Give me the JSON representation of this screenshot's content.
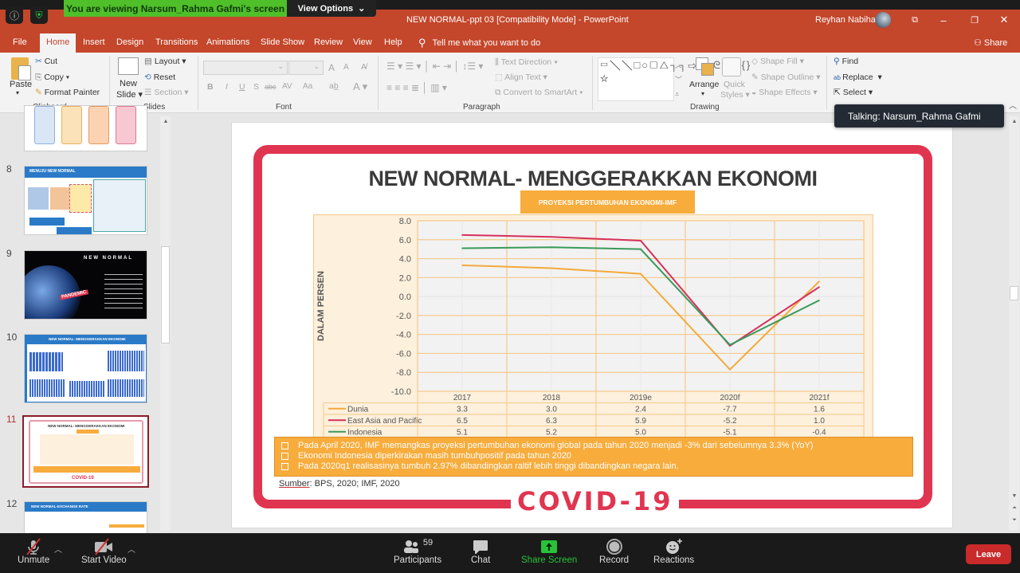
{
  "zoom": {
    "viewing_banner": "You are viewing Narsum_Rahma Gafmi's screen",
    "view_options": "View Options",
    "talking": "Talking: Narsum_Rahma Gafmi",
    "toolbar": {
      "unmute": "Unmute",
      "start_video": "Start Video",
      "participants": "Participants",
      "participants_count": "59",
      "chat": "Chat",
      "share_screen": "Share Screen",
      "record": "Record",
      "reactions": "Reactions",
      "leave": "Leave"
    },
    "colors": {
      "share_green": "#29c23a",
      "leave_red": "#c92a2a",
      "banner_green": "#4fbf2a"
    }
  },
  "powerpoint": {
    "window_title": "NEW NORMAL-ppt 03 [Compatibility Mode]  -  PowerPoint",
    "user_name": "Reyhan Nabiha",
    "tabs": [
      "File",
      "Home",
      "Insert",
      "Design",
      "Transitions",
      "Animations",
      "Slide Show",
      "Review",
      "View",
      "Help"
    ],
    "active_tab": "Home",
    "tell_me": "Tell me what you want to do",
    "share": "Share",
    "accent_color": "#c4462b",
    "ribbon": {
      "clipboard": {
        "label": "Clipboard",
        "paste": "Paste",
        "cut": "Cut",
        "copy": "Copy",
        "format_painter": "Format Painter"
      },
      "slides": {
        "label": "Slides",
        "new_slide_1": "New",
        "new_slide_2": "Slide",
        "layout": "Layout",
        "reset": "Reset",
        "section": "Section"
      },
      "font": {
        "label": "Font",
        "bold": "B",
        "italic": "I",
        "underline": "U",
        "strike": "S",
        "abc": "abc",
        "spacing": "AV",
        "case": "Aa",
        "grow": "A",
        "shrink": "A"
      },
      "paragraph": {
        "label": "Paragraph",
        "text_direction": "Text Direction",
        "align_text": "Align Text",
        "convert_smartart": "Convert to SmartArt"
      },
      "drawing": {
        "label": "Drawing",
        "arrange": "Arrange",
        "quick_styles_1": "Quick",
        "quick_styles_2": "Styles",
        "shape_fill": "Shape Fill",
        "shape_outline": "Shape Outline",
        "shape_effects": "Shape Effects",
        "shapes_glyphs": "▭╲╲□○▢△┐┐⇨⇩◺ᘓ⌒⌒{}☆"
      },
      "editing": {
        "find": "Find",
        "replace": "Replace",
        "select": "Select"
      }
    },
    "thumbnails": [
      {
        "num": "8",
        "title": "MENUJU NEW NORMAL"
      },
      {
        "num": "9",
        "title": "NEW NORMAL"
      },
      {
        "num": "10",
        "title": "NEW NORMAL- MENGGERAKKAN EKONOMI"
      },
      {
        "num": "11",
        "title": "NEW NORMAL- MENGGERAKKAN EKONOMI",
        "selected": true
      },
      {
        "num": "12",
        "title": "NEW NORMAL-EXCHANGE RATE"
      }
    ],
    "thumb_labels": {
      "pandemic": "PANDEMIC",
      "covid": "COVID-19"
    }
  },
  "slide": {
    "title": "NEW NORMAL- MENGGERAKKAN EKONOMI",
    "subtitle_box": "PROYEKSI PERTUMBUHAN EKONOMI-IMF",
    "bullets": [
      "Pada April 2020, IMF memangkas proyeksi pertumbuhan ekonomi global pada tahun 2020 menjadi -3% dari sebelumnya 3.3% (YoY)",
      "Ekonomi Indonesia diperkirakan masih tumbuhpositif pada tahun 2020",
      "Pada 2020q1 realisasinya tumbuh 2.97% dibandingkan raltif lebih tinggi dibandingkan negara lain."
    ],
    "source_label": "Sumber",
    "source_text": ": BPS, 2020; IMF, 2020",
    "covid_stamp": "COVID-19",
    "stamp_color": "#e03550",
    "orange": "#f7ac3c"
  },
  "chart_data": {
    "type": "line",
    "title": "PROYEKSI PERTUMBUHAN EKONOMI-IMF",
    "xlabel": "",
    "ylabel": "DALAM PERSEN",
    "categories": [
      "2017",
      "2018",
      "2019e",
      "2020f",
      "2021f"
    ],
    "ylim": [
      -10,
      8
    ],
    "yticks": [
      "8.0",
      "6.0",
      "4.0",
      "2.0",
      "0.0",
      "-2.0",
      "-4.0",
      "-6.0",
      "-8.0",
      "-10.0"
    ],
    "grid": true,
    "legend": "data-table-bottom",
    "series": [
      {
        "name": "Dunia",
        "color": "#f5a93a",
        "values": [
          3.3,
          3.0,
          2.4,
          -7.7,
          1.6
        ],
        "labels": [
          "3.3",
          "3.0",
          "2.4",
          "-7.7",
          "1.6"
        ]
      },
      {
        "name": "East Asia and Pacific",
        "color": "#d6305a",
        "values": [
          6.5,
          6.3,
          5.9,
          -5.2,
          1.0
        ],
        "labels": [
          "6.5",
          "6.3",
          "5.9",
          "-5.2",
          "1.0"
        ]
      },
      {
        "name": "Indonesia",
        "color": "#3a9a5a",
        "values": [
          5.1,
          5.2,
          5.0,
          -5.1,
          -0.4
        ],
        "labels": [
          "5.1",
          "5.2",
          "5.0",
          "-5.1",
          "-0.4"
        ]
      }
    ]
  }
}
